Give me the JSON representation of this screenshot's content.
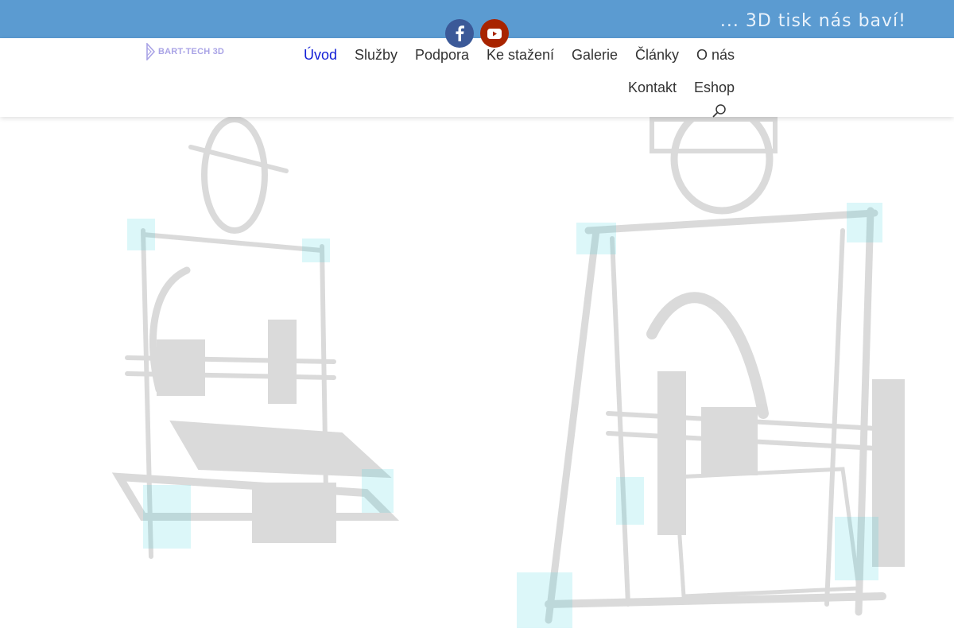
{
  "topbar": {
    "tagline": "... 3D tisk nás baví!",
    "color": "#5b9bd1"
  },
  "social": [
    {
      "name": "facebook",
      "icon": "facebook-icon",
      "color": "#3b5998"
    },
    {
      "name": "youtube",
      "icon": "youtube-icon",
      "color": "#a82400"
    }
  ],
  "header": {
    "logo_text": "BART-TECH 3D",
    "nav": [
      {
        "label": "Úvod",
        "active": true
      },
      {
        "label": "Služby"
      },
      {
        "label": "Podpora"
      },
      {
        "label": "Ke stažení"
      },
      {
        "label": "Galerie"
      },
      {
        "label": "Články"
      },
      {
        "label": "O nás"
      },
      {
        "label": "Kontakt"
      },
      {
        "label": "Eshop"
      }
    ],
    "search_icon": "search-icon",
    "active_color": "#1420d6"
  },
  "hero": {
    "image": "faded-3d-printers-background",
    "accent": "#9ee8ee"
  }
}
